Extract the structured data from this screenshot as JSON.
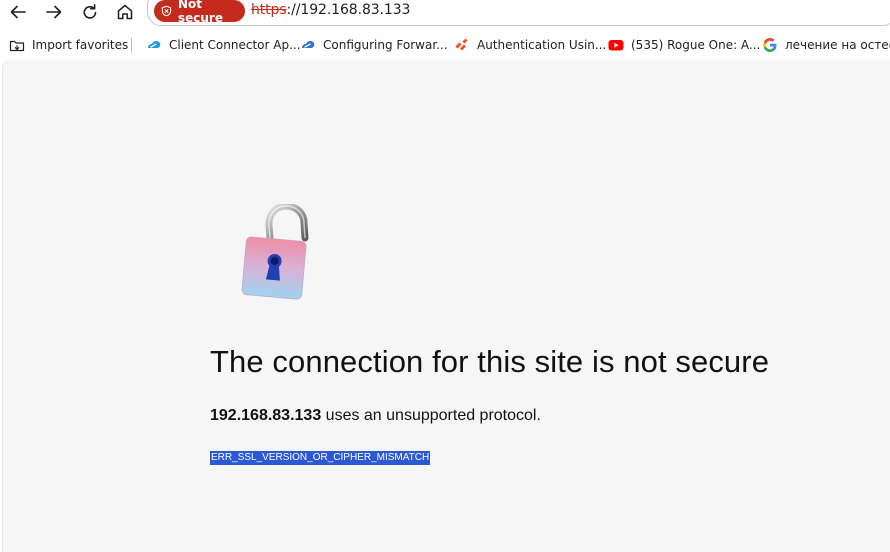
{
  "browser": {
    "security_badge": "Not secure",
    "url_scheme": "https",
    "url_rest": "://192.168.83.133"
  },
  "favorites": [
    {
      "label": "Import favorites",
      "icon": "import-favorites-icon"
    },
    {
      "label": "Client Connector Ap...",
      "icon": "zscaler-icon"
    },
    {
      "label": "Configuring Forwar...",
      "icon": "zscaler-icon"
    },
    {
      "label": "Authentication Usin...",
      "icon": "paloalto-icon"
    },
    {
      "label": "(535) Rogue One: A...",
      "icon": "youtube-icon"
    },
    {
      "label": "лечение на остеоп...",
      "icon": "google-icon"
    }
  ],
  "error": {
    "title": "The connection for this site is not secure",
    "host": "192.168.83.133",
    "message": " uses an unsupported protocol.",
    "code": "ERR_SSL_VERSION_OR_CIPHER_MISMATCH"
  },
  "colors": {
    "not_secure_badge": "#c42b1c",
    "page_background": "#f6f6f6",
    "selection_highlight": "#2b59d6"
  }
}
